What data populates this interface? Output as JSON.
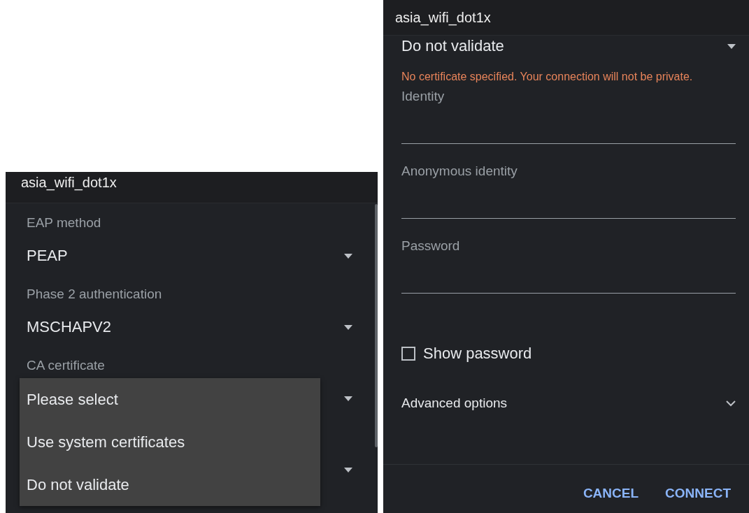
{
  "left_dialog": {
    "title": "asia_wifi_dot1x",
    "fields": [
      {
        "kind": "select",
        "label": "EAP method",
        "value": "PEAP"
      },
      {
        "kind": "select",
        "label": "Phase 2 authentication",
        "value": "MSCHAPV2"
      },
      {
        "kind": "select",
        "label": "CA certificate"
      },
      {
        "kind": "select"
      }
    ],
    "dropdown_menu": [
      {
        "label": "Please select"
      },
      {
        "label": "Use system certificates"
      },
      {
        "label": "Do not validate"
      }
    ]
  },
  "right_dialog": {
    "title": "asia_wifi_dot1x",
    "fields": [
      {
        "kind": "select",
        "value": "Do not validate"
      },
      {
        "kind": "warning",
        "text": "No certificate specified. Your connection will not be private."
      },
      {
        "kind": "input",
        "placeholder": "Identity"
      },
      {
        "kind": "input",
        "placeholder": "Anonymous identity"
      },
      {
        "kind": "input",
        "placeholder": "Password"
      },
      {
        "kind": "checkbox",
        "label": "Show password",
        "checked": false
      },
      {
        "kind": "expander",
        "label": "Advanced options",
        "expanded": false
      }
    ],
    "buttons": [
      "CANCEL",
      "CONNECT"
    ]
  }
}
